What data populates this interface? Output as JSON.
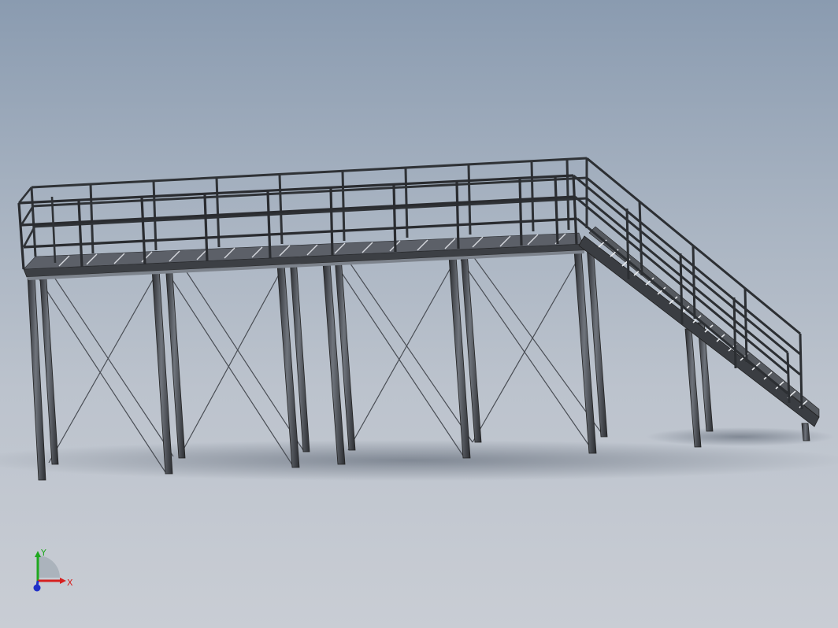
{
  "viewport": {
    "background_top": "#8a9bb0",
    "background_bottom": "#c9cdd4"
  },
  "model": {
    "steel_color": "#3c3f44",
    "steel_highlight": "#7d838c",
    "bracing_color": "#4a4e55",
    "shadow_color": "#6e7682"
  },
  "triad": {
    "x_label": "X",
    "y_label": "Y",
    "x_color": "#d62020",
    "y_color": "#1fa81f",
    "z_color": "#2030c8"
  }
}
